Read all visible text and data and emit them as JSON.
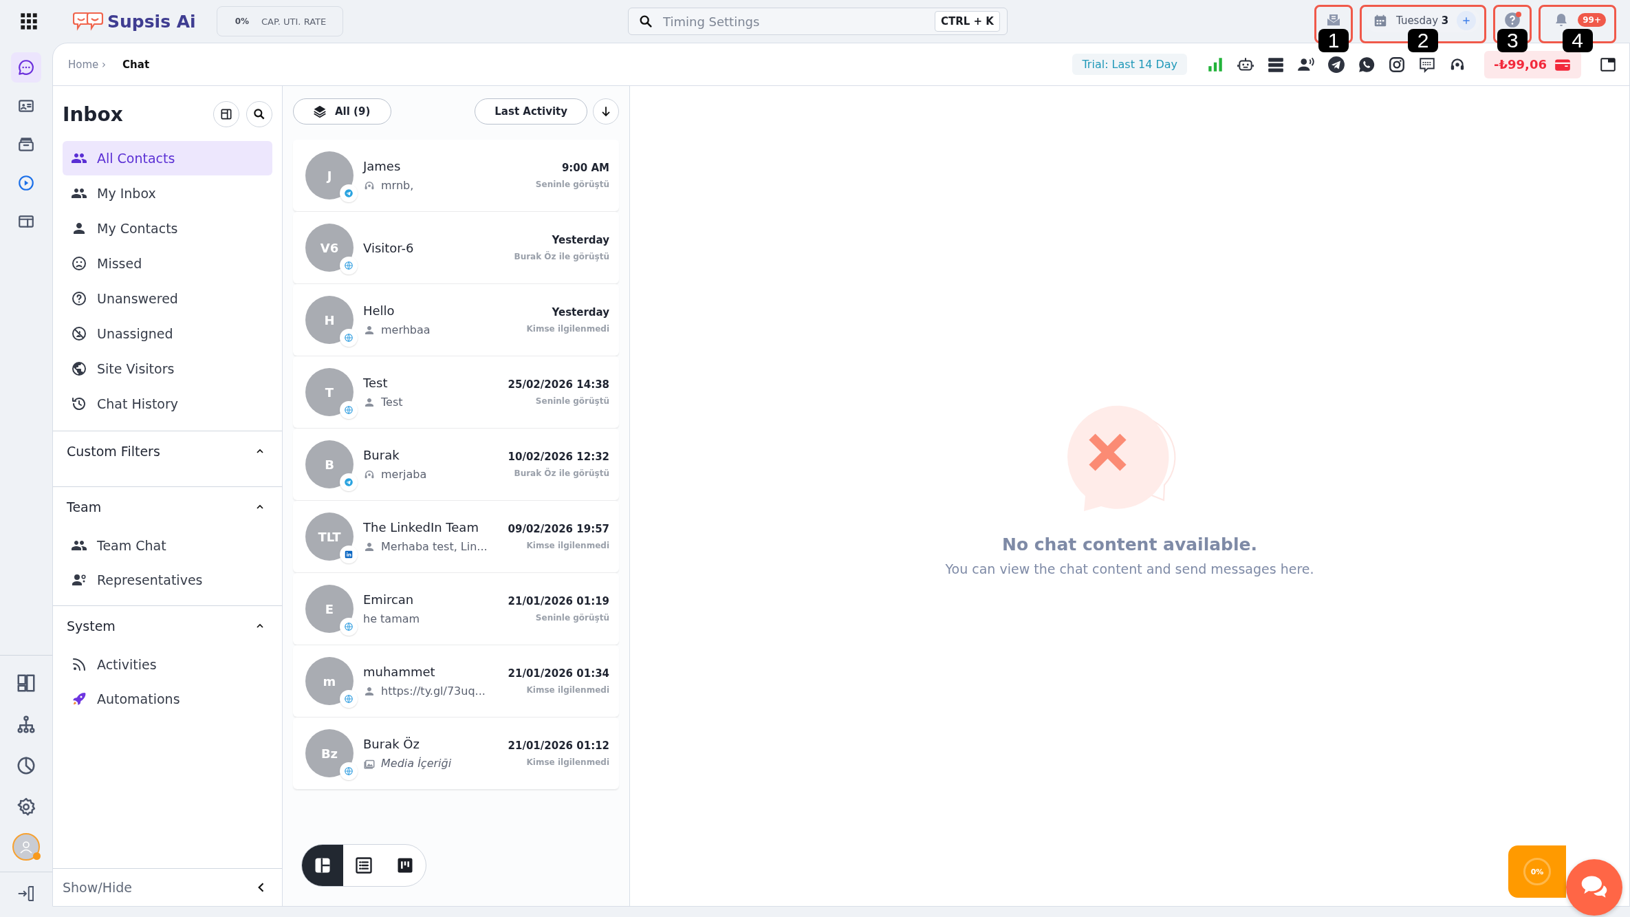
{
  "topbar": {
    "brand": "Supsis Ai",
    "cap_rate": {
      "value": "0%",
      "label": "CAP. UTI. RATE"
    },
    "search": {
      "placeholder": "Timing Settings",
      "shortcut": "CTRL + K"
    },
    "date": {
      "day": "Tuesday",
      "number": "3"
    },
    "help": {
      "unread": true
    },
    "notifications": {
      "count": "99+"
    }
  },
  "callouts": [
    "1",
    "2",
    "3",
    "4"
  ],
  "rail": {
    "top": [
      {
        "kind": "chat",
        "selected": true
      },
      {
        "kind": "contacts",
        "selected": false
      },
      {
        "kind": "archive",
        "selected": false
      },
      {
        "kind": "play",
        "selected": false
      },
      {
        "kind": "layout",
        "selected": false
      }
    ],
    "bottom": [
      {
        "kind": "dashboard",
        "selected": false
      },
      {
        "kind": "sitemap",
        "selected": false
      },
      {
        "kind": "pie",
        "selected": false
      },
      {
        "kind": "settings",
        "selected": false
      }
    ],
    "user": {
      "online": true
    }
  },
  "breadcrumb": {
    "parent": "Home",
    "separator": "›",
    "current": "Chat"
  },
  "toolbar": {
    "trial": "Trial: Last 14 Day",
    "balance": "-₺99,06"
  },
  "inbox": {
    "title": "Inbox",
    "items": [
      {
        "label": "All Contacts",
        "kind": "people",
        "selected": true
      },
      {
        "label": "My Inbox",
        "kind": "people",
        "selected": false
      },
      {
        "label": "My Contacts",
        "kind": "person",
        "selected": false
      },
      {
        "label": "Missed",
        "kind": "sad",
        "selected": false
      },
      {
        "label": "Unanswered",
        "kind": "question",
        "selected": false
      },
      {
        "label": "Unassigned",
        "kind": "unassigned",
        "selected": false
      },
      {
        "label": "Site Visitors",
        "kind": "globe",
        "selected": false
      },
      {
        "label": "Chat History",
        "kind": "history",
        "selected": false
      }
    ],
    "sections": [
      {
        "title": "Custom Filters",
        "expanded": true
      },
      {
        "title": "Team",
        "expanded": true,
        "items": [
          {
            "label": "Team Chat",
            "kind": "people"
          },
          {
            "label": "Representatives",
            "kind": "reps"
          }
        ]
      },
      {
        "title": "System",
        "expanded": true,
        "items": [
          {
            "label": "Activities",
            "kind": "rss"
          },
          {
            "label": "Automations",
            "kind": "rocket"
          }
        ]
      }
    ],
    "footer": "Show/Hide"
  },
  "chat_list": {
    "filter": "All (9)",
    "sort": "Last Activity",
    "conversations": [
      {
        "initials": "J",
        "name": "James",
        "time": "9:00 AM",
        "kind": "telegram",
        "preview": {
          "kind": "agent",
          "text": "mrnb,"
        },
        "status": "Seninle görüştü"
      },
      {
        "initials": "V6",
        "name": "Visitor-6",
        "time": "Yesterday",
        "kind": "web",
        "status": "Burak Öz ile görüştü"
      },
      {
        "initials": "H",
        "name": "Hello",
        "time": "Yesterday",
        "kind": "web",
        "preview": {
          "kind": "person",
          "text": "merhbaa"
        },
        "status": "Kimse ilgilenmedi"
      },
      {
        "initials": "T",
        "name": "Test",
        "time": "25/02/2026 14:38",
        "kind": "web",
        "preview": {
          "kind": "person",
          "text": "Test"
        },
        "status": "Seninle görüştü"
      },
      {
        "initials": "B",
        "name": "Burak",
        "time": "10/02/2026 12:32",
        "kind": "telegram",
        "preview": {
          "kind": "agent",
          "text": "merjaba"
        },
        "status": "Burak Öz ile görüştü"
      },
      {
        "initials": "TLT",
        "name": "The LinkedIn Team",
        "time": "09/02/2026 19:57",
        "kind": "linkedin",
        "preview": {
          "kind": "person",
          "text": "Merhaba test, Lin..."
        },
        "status": "Kimse ilgilenmedi"
      },
      {
        "initials": "E",
        "name": "Emircan",
        "time": "21/01/2026 01:19",
        "kind": "web",
        "preview": {
          "kind": "text",
          "text": "he tamam"
        },
        "status": "Seninle görüştü"
      },
      {
        "initials": "m",
        "name": "muhammet",
        "time": "21/01/2026 01:34",
        "kind": "web",
        "preview": {
          "kind": "person",
          "text": "https://ty.gl/73uq..."
        },
        "status": "Kimse ilgilenmedi"
      },
      {
        "initials": "Bz",
        "name": "Burak Öz",
        "time": "21/01/2026 01:12",
        "kind": "web",
        "preview": {
          "kind": "media",
          "text": "Media İçeriği"
        },
        "status": "Kimse ilgilenmedi"
      }
    ],
    "views": [
      {
        "kind": "board",
        "selected": true
      },
      {
        "kind": "list",
        "selected": false
      },
      {
        "kind": "kanban",
        "selected": false
      }
    ]
  },
  "empty_state": {
    "title": "No chat content available.",
    "text": "You can view the chat content and send messages here."
  },
  "widget": {
    "progress": "0%"
  }
}
